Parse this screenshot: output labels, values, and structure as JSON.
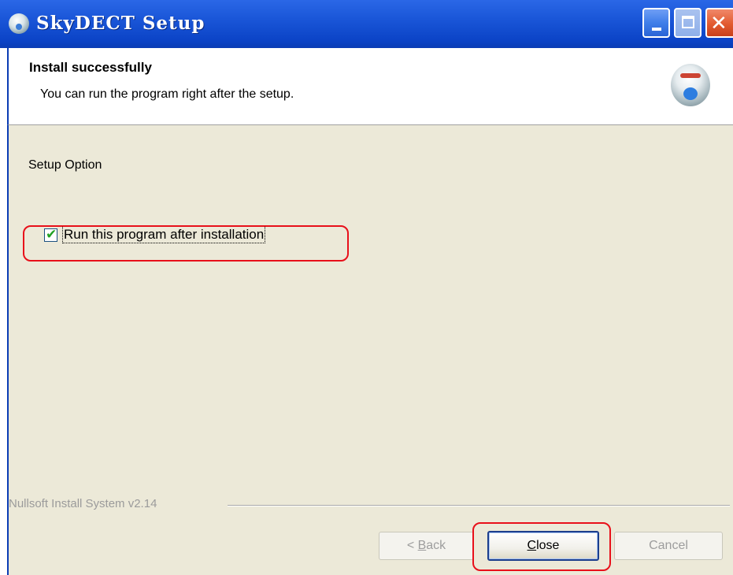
{
  "window": {
    "title": "SkyDECT Setup",
    "controls": {
      "minimize": "minimize",
      "maximize": "maximize",
      "close": "✕"
    }
  },
  "header": {
    "title": "Install successfully",
    "subtitle": "You can run the program right after the setup."
  },
  "body": {
    "section_label": "Setup Option",
    "run_checkbox": {
      "label": "Run this program after installation",
      "checked": true
    }
  },
  "footer": {
    "branding": "Nullsoft Install System v2.14",
    "buttons": {
      "back": {
        "prefix": "< ",
        "accel": "B",
        "rest": "ack",
        "enabled": false
      },
      "close": {
        "accel": "C",
        "rest": "lose",
        "enabled": true
      },
      "cancel": {
        "label": "Cancel",
        "enabled": false
      }
    }
  },
  "annotations": {
    "highlight_color": "#e8101a"
  },
  "colors": {
    "titlebar": "#0a3cb4",
    "panel": "#ece9d8",
    "checkmark": "#21a121"
  }
}
